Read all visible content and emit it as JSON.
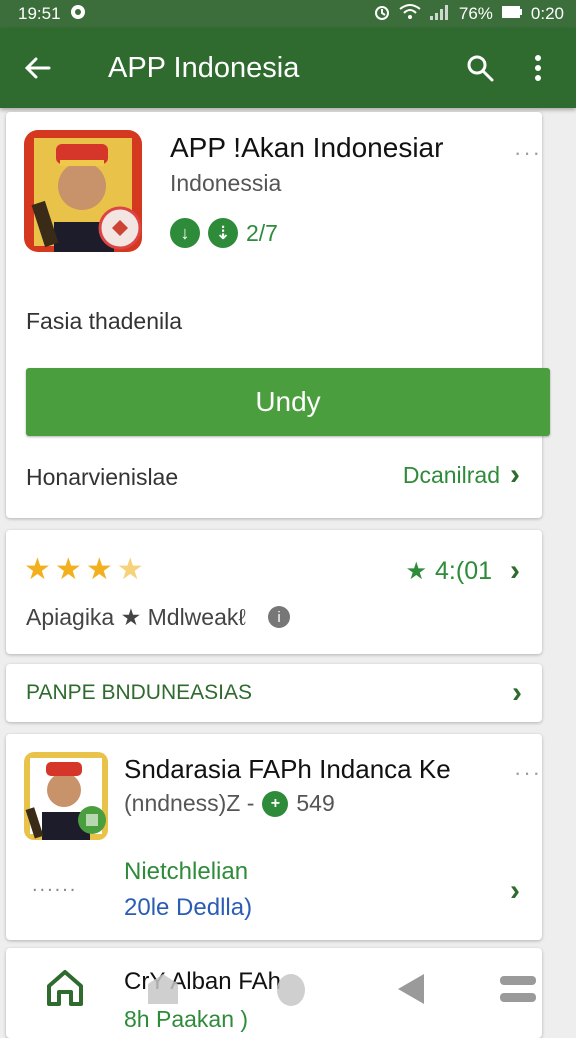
{
  "status_bar": {
    "time": "19:51",
    "battery": "76%",
    "clock_right": "0:20"
  },
  "app_bar": {
    "title": "APP Indonesia"
  },
  "app_card": {
    "title": "APP !Akan Indonesiar",
    "developer": "Indonessia",
    "badge_count": "2/7",
    "description": "Fasia thadenila",
    "install_label": "Undy",
    "footer_left": "Honarvienislae",
    "footer_link": "Dcanilrad"
  },
  "rating_card": {
    "stars": 3.5,
    "rating_value": "4:(01",
    "caption": "Apiagika ★ Mdlweakℓ"
  },
  "section_header": {
    "label": "PANPE BNDUNEASIAS"
  },
  "related_card": {
    "title": "Sndarasia FAPh Indanca Ke",
    "subtitle": "(nndness)Z -",
    "count": "549",
    "green_line": "Nietchlelian",
    "blue_line": "20le Dedlla)",
    "dots_left": "......"
  },
  "partial_card": {
    "title": "CrY   Alban  FAh",
    "subtitle": "8h  Paakan )"
  },
  "colors": {
    "status_bar": "#3b6e3a",
    "app_bar": "#2f6a2e",
    "install": "#4a9e3d",
    "accent_green": "#2e8b3a",
    "star": "#f2b01e",
    "link_blue": "#2b5db5"
  }
}
